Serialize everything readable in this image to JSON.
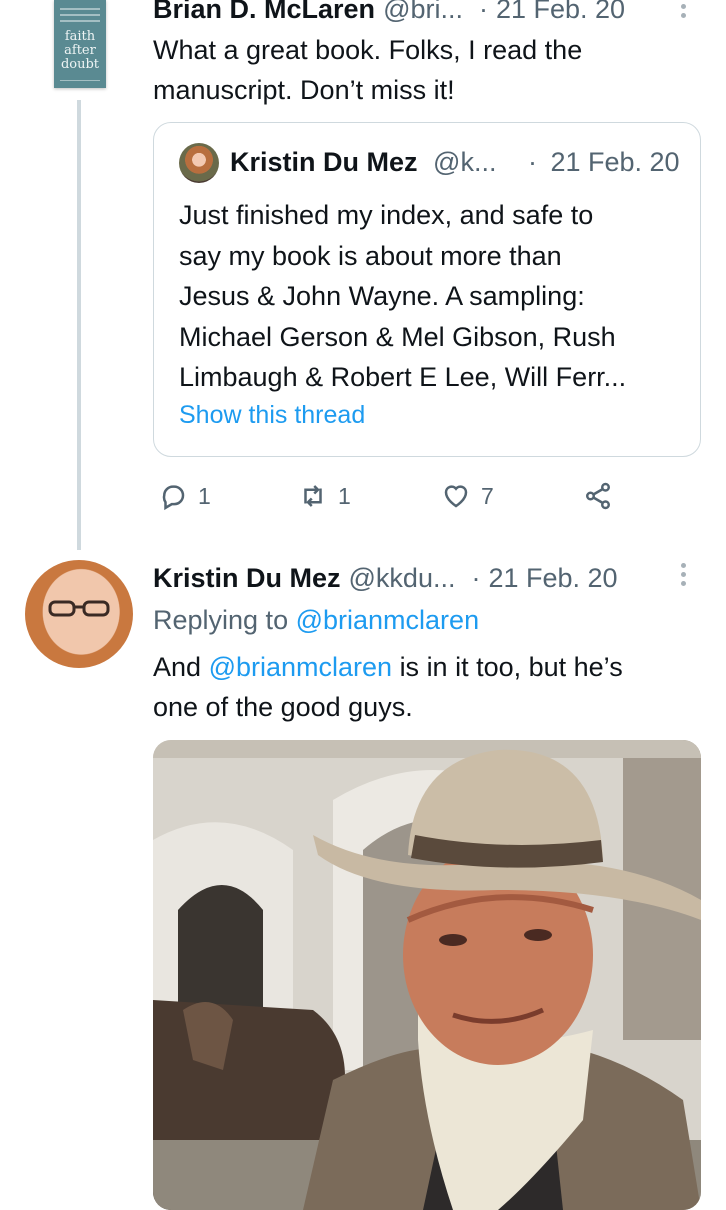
{
  "tweet1": {
    "author_name": "Brian D. McLaren",
    "handle": "@bri...",
    "date": "21 Feb. 20",
    "separator": "·",
    "avatar_book_title": [
      "faith",
      "after",
      "doubt"
    ],
    "text_lines": [
      "What a great book. Folks, I read the",
      "manuscript. Don’t miss it!"
    ],
    "quoted": {
      "author_name": "Kristin Du Mez",
      "handle": "@k...",
      "date": "21 Feb. 20",
      "text_lines": [
        "Just finished my index, and safe to",
        "say my book is about more than",
        "Jesus & John Wayne. A sampling:",
        "Michael Gerson & Mel Gibson, Rush",
        "Limbaugh & Robert E Lee, Will Ferr..."
      ],
      "show_thread": "Show this thread"
    },
    "actions": {
      "reply_count": "1",
      "retweet_count": "1",
      "like_count": "7"
    }
  },
  "tweet2": {
    "author_name": "Kristin Du Mez",
    "handle": "@kkdu...",
    "date": "21 Feb. 20",
    "separator": "·",
    "replying_prefix": "Replying to",
    "replying_handle": "@brianmclaren",
    "text_mention": "@brianmclaren",
    "text_line1_start": "And",
    "text_line1_end": "is in it too, but he’s",
    "text_line2": "one of the good guys."
  },
  "icons": {
    "reply": "reply-icon",
    "retweet": "retweet-icon",
    "like": "heart-icon",
    "share": "share-icon",
    "more": "more-icon"
  },
  "colors": {
    "accent": "#1d9bf0",
    "muted": "#536471",
    "border": "#cfd9de",
    "text": "#0f1419"
  }
}
